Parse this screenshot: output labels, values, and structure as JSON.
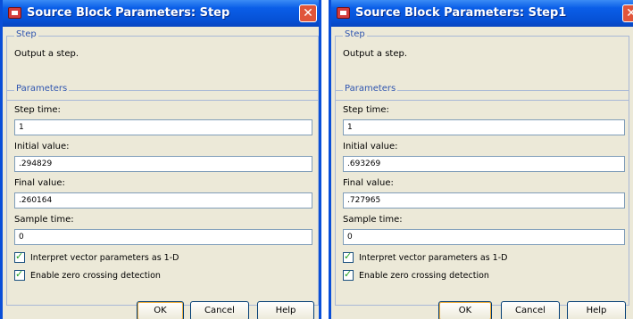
{
  "windows": [
    {
      "title": "Source Block Parameters: Step",
      "close_glyph": "✕",
      "step_group": "Step",
      "description": "Output a step.",
      "params_group": "Parameters",
      "fields": [
        {
          "label": "Step time:",
          "value": "1"
        },
        {
          "label": "Initial value:",
          "value": ".294829"
        },
        {
          "label": "Final value:",
          "value": ".260164"
        },
        {
          "label": "Sample time:",
          "value": "0"
        }
      ],
      "checkboxes": [
        {
          "label": "Interpret vector parameters as 1-D",
          "checked": true
        },
        {
          "label": "Enable zero crossing detection",
          "checked": true
        }
      ],
      "buttons": {
        "ok": "OK",
        "cancel": "Cancel",
        "help": "Help"
      }
    },
    {
      "title": "Source Block Parameters: Step1",
      "close_glyph": "✕",
      "step_group": "Step",
      "description": "Output a step.",
      "params_group": "Parameters",
      "fields": [
        {
          "label": "Step time:",
          "value": "1"
        },
        {
          "label": "Initial value:",
          "value": ".693269"
        },
        {
          "label": "Final value:",
          "value": ".727965"
        },
        {
          "label": "Sample time:",
          "value": "0"
        }
      ],
      "checkboxes": [
        {
          "label": "Interpret vector parameters as 1-D",
          "checked": true
        },
        {
          "label": "Enable zero crossing detection",
          "checked": true
        }
      ],
      "buttons": {
        "ok": "OK",
        "cancel": "Cancel",
        "help": "Help"
      }
    }
  ],
  "check_glyph": "✓"
}
